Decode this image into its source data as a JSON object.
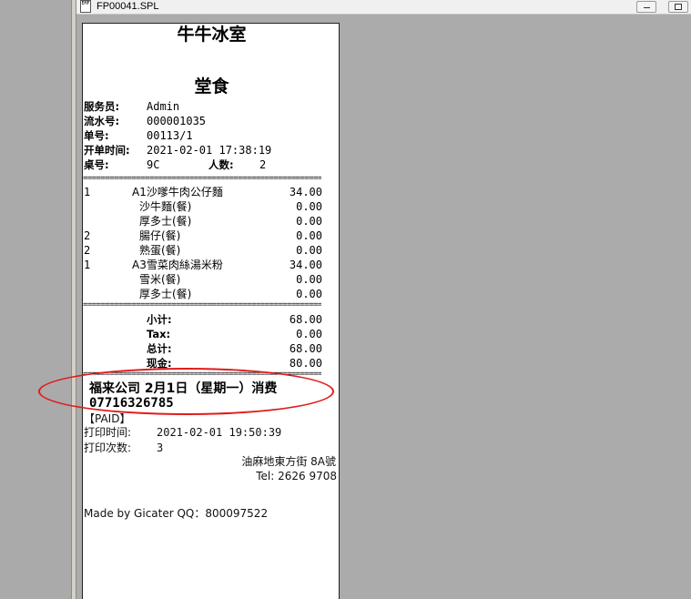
{
  "window": {
    "title": "FP00041.SPL",
    "doc_icon_label": "EMF"
  },
  "receipt": {
    "store_name": "牛牛冰室",
    "order_type": "堂食",
    "fields": [
      {
        "label": "服务员:",
        "value": "Admin"
      },
      {
        "label": "流水号:",
        "value": "000001035"
      },
      {
        "label": "单号:",
        "value": "00113/1"
      },
      {
        "label": "开单时间:",
        "value": "2021-02-01 17:38:19"
      }
    ],
    "table_label": "桌号:",
    "table_value": "9C",
    "guests_label": "人数:",
    "guests_value": "2",
    "separator": "==========================================================",
    "items": [
      {
        "qty": "1",
        "name": "A1沙嗲牛肉公仔麵",
        "amount": "34.00"
      },
      {
        "qty": "",
        "name": "沙牛麵(餐)",
        "amount": "0.00"
      },
      {
        "qty": "",
        "name": "厚多士(餐)",
        "amount": "0.00"
      },
      {
        "qty": "2",
        "name": "腸仔(餐)",
        "amount": "0.00"
      },
      {
        "qty": "2",
        "name": "熟蛋(餐)",
        "amount": "0.00"
      },
      {
        "qty": "1",
        "name": "A3雪菜肉絲湯米粉",
        "amount": "34.00"
      },
      {
        "qty": "",
        "name": "雪米(餐)",
        "amount": "0.00"
      },
      {
        "qty": "",
        "name": "厚多士(餐)",
        "amount": "0.00"
      }
    ],
    "totals": [
      {
        "label": "小计:",
        "value": "68.00"
      },
      {
        "label": "Tax:",
        "value": "0.00"
      },
      {
        "label": "总计:",
        "value": "68.00"
      },
      {
        "label": "现金:",
        "value": "80.00"
      }
    ],
    "customer_line": "福来公司 2月1日（星期一）消费",
    "phone": "07716326785",
    "paid_label": "【PAID】",
    "print_time_label": "打印时间:",
    "print_time_value": "2021-02-01 19:50:39",
    "print_count_label": "打印次数:",
    "print_count_value": "3",
    "address": "油麻地東方街 8A號",
    "tel": "Tel: 2626 9708",
    "footer": "Made by Gicater QQ：800097522"
  },
  "annotation": {
    "circle_color": "#e01b1b"
  }
}
